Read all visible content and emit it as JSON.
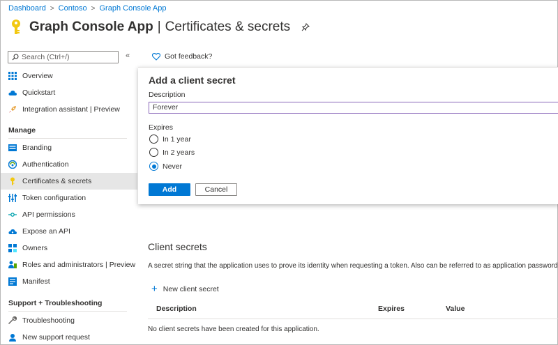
{
  "breadcrumb": [
    "Dashboard",
    "Contoso",
    "Graph Console App"
  ],
  "header": {
    "app_name": "Graph Console App",
    "separator": "|",
    "page_name": "Certificates & secrets"
  },
  "sidebar": {
    "search_placeholder": "Search (Ctrl+/)",
    "collapse": "«",
    "items_top": [
      {
        "label": "Overview",
        "icon": "grid-icon"
      },
      {
        "label": "Quickstart",
        "icon": "cloud-icon"
      },
      {
        "label": "Integration assistant | Preview",
        "icon": "rocket-icon"
      }
    ],
    "manage_heading": "Manage",
    "items_manage": [
      {
        "label": "Branding",
        "icon": "branding-icon"
      },
      {
        "label": "Authentication",
        "icon": "authentication-icon"
      },
      {
        "label": "Certificates & secrets",
        "icon": "key-icon",
        "active": true
      },
      {
        "label": "Token configuration",
        "icon": "token-icon"
      },
      {
        "label": "API permissions",
        "icon": "api-icon"
      },
      {
        "label": "Expose an API",
        "icon": "cloud-api-icon"
      },
      {
        "label": "Owners",
        "icon": "owners-icon"
      },
      {
        "label": "Roles and administrators | Preview",
        "icon": "roles-icon"
      },
      {
        "label": "Manifest",
        "icon": "manifest-icon"
      }
    ],
    "support_heading": "Support + Troubleshooting",
    "items_support": [
      {
        "label": "Troubleshooting",
        "icon": "wrench-icon"
      },
      {
        "label": "New support request",
        "icon": "support-icon"
      }
    ]
  },
  "feedback": "Got feedback?",
  "panel": {
    "heading": "Add a client secret",
    "description_label": "Description",
    "description_value": "Forever",
    "expires_label": "Expires",
    "options": [
      "In 1 year",
      "In 2 years",
      "Never"
    ],
    "selected_option": "Never",
    "add_label": "Add",
    "cancel_label": "Cancel"
  },
  "client_secrets": {
    "title": "Client secrets",
    "description": "A secret string that the application uses to prove its identity when requesting a token. Also can be referred to as application password.",
    "new_label": "New client secret",
    "columns": [
      "Description",
      "Expires",
      "Value"
    ],
    "empty_text": "No client secrets have been created for this application."
  },
  "colors": {
    "accent": "#0078d4",
    "key_yellow": "#f2c811",
    "input_focus": "#8764b8"
  }
}
